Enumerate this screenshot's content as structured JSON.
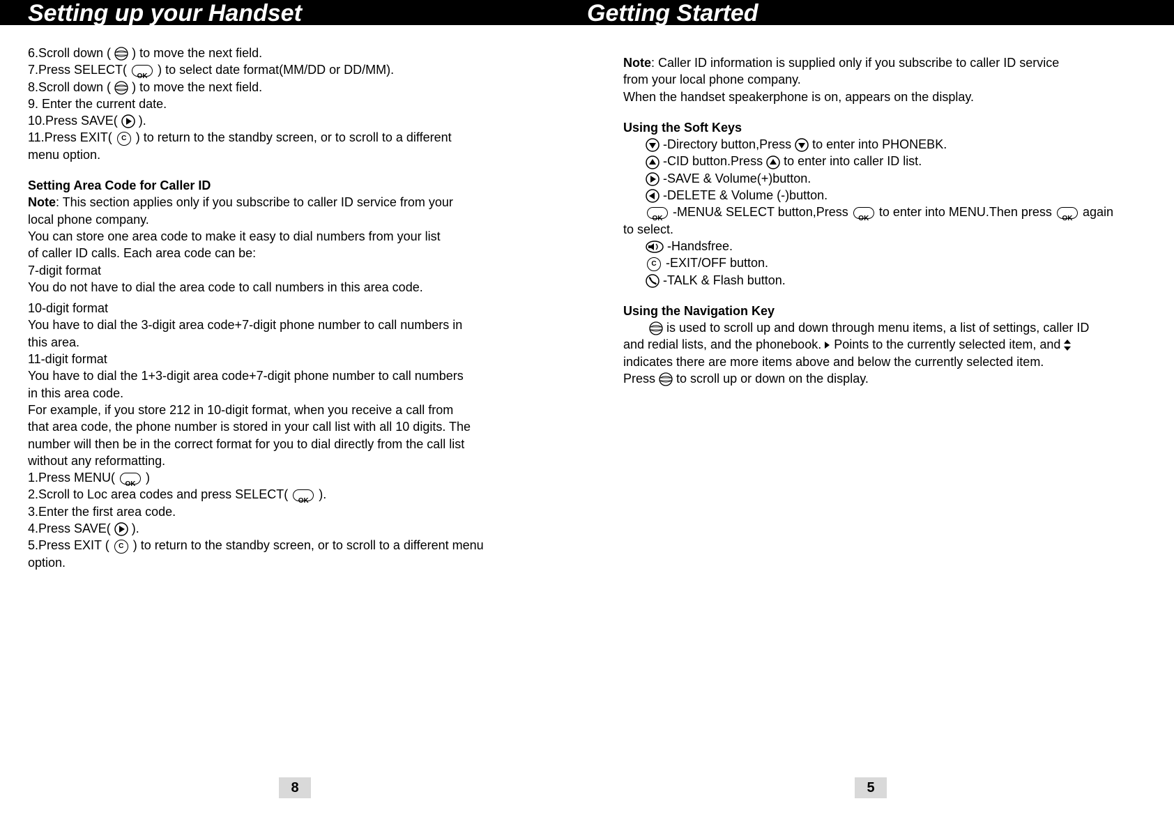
{
  "header": {
    "left_title": "Setting up your Handset",
    "right_title": "Getting Started"
  },
  "left": {
    "s6a": "6.Scroll down (",
    "s6b": ") to move the next field.",
    "s7a": "7.Press SELECT(",
    "s7b": ") to select date format(MM/DD or DD/MM).",
    "s8a": "8.Scroll down (",
    "s8b": ") to move the next field.",
    "s9": "9. Enter the current date.",
    "s10a": "10.Press SAVE(",
    "s10b": ").",
    "s11a": "11.Press EXIT(",
    "s11b": ") to return to the standby screen, or   to scroll to a different",
    "s11c": "menu option.",
    "sec2_title": "Setting Area Code for Caller ID",
    "note_label": "Note",
    "sec2_note": ": This section applies only if you subscribe to caller ID service from your",
    "sec2_note2": "local phone company.",
    "sec2_a": "You can store one area code  to make it easy to dial numbers from your list",
    "sec2_b": "of caller ID calls. Each area code can be:",
    "fmt7": "7-digit format",
    "fmt7b": "You do not have to dial the area code to call numbers in this area code.",
    "fmt10": "10-digit format",
    "fmt10b": "You have to dial the 3-digit area code+7-digit phone number to call numbers in",
    "fmt10c": "this area.",
    "fmt11": "11-digit format",
    "fmt11b": "You have to dial the 1+3-digit area code+7-digit phone number to call numbers",
    "fmt11c": "in this area code.",
    "ex1": "For example, if you store 212 in 10-digit format, when you receive a call from",
    "ex2": "that area code, the phone number is stored in your call list with all 10 digits. The",
    "ex3": "number will then be in the correct format for you to dial directly from the call list",
    "ex4": "without any reformatting.",
    "st1a": "1.Press MENU(",
    "st1b": ")",
    "st2a": "2.Scroll to Loc area codes and press SELECT(",
    "st2b": ").",
    "st3": "3.Enter the first area code.",
    "st4a": "4.Press SAVE(",
    "st4b": ").",
    "st5a": "5.Press EXIT (",
    "st5b": ") to return to the standby screen, or to scroll to a different menu",
    "st5c": "option."
  },
  "right": {
    "note_label": "Note",
    "note1": ": Caller ID information is supplied only if you subscribe to caller ID service",
    "note2": "from your local phone company.",
    "note3": " When the handset speakerphone is on,    appears on the display.",
    "sk_title": "Using the Soft Keys",
    "sk1a": "-Directory button,Press",
    "sk1b": "to enter into PHONEBK.",
    "sk2a": "-CID button.Press",
    "sk2b": "to enter into caller ID list.",
    "sk3": "-SAVE & Volume(+)button.",
    "sk4": "-DELETE & Volume (-)button.",
    "sk5a": "-MENU& SELECT button,Press",
    "sk5b": "to enter into MENU.Then press",
    "sk5c": "again",
    "sk5d": "to select.",
    "sk6": "-Handsfree.",
    "sk7": "-EXIT/OFF button.",
    "sk8": "-TALK & Flash button.",
    "nav_title": "Using the Navigation Key",
    "nav1": "is used to scroll up and down through menu items, a list of settings, caller ID",
    "nav2a": "and redial lists, and the phonebook.",
    "nav2b": "Points to the currently selected item, and",
    "nav3": " indicates there are more items above and below the currently selected item.",
    "nav4a": "Press",
    "nav4b": "to scroll up or down on the display."
  },
  "pages": {
    "left": "8",
    "right": "5"
  },
  "icons": {
    "ok": "OK",
    "c": "C"
  }
}
